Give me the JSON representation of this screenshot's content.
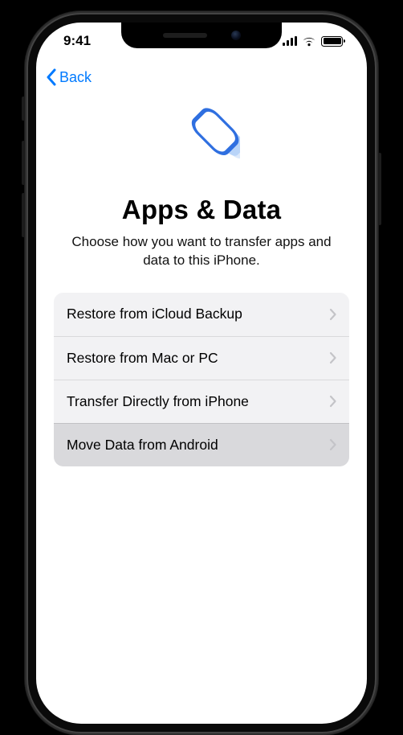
{
  "statusbar": {
    "time": "9:41"
  },
  "nav": {
    "back_label": "Back"
  },
  "header": {
    "title": "Apps & Data",
    "subtitle": "Choose how you want to transfer apps and data to this iPhone."
  },
  "options": [
    {
      "label": "Restore from iCloud Backup",
      "selected": false
    },
    {
      "label": "Restore from Mac or PC",
      "selected": false
    },
    {
      "label": "Transfer Directly from iPhone",
      "selected": false
    },
    {
      "label": "Move Data from Android",
      "selected": true
    }
  ],
  "colors": {
    "accent": "#007aff"
  }
}
